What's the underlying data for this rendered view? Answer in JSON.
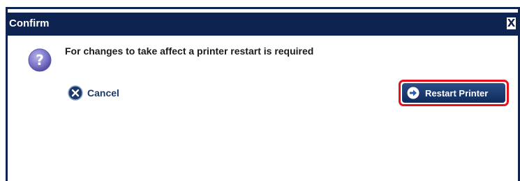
{
  "dialog": {
    "title": "Confirm",
    "close_label": "X",
    "message": "For changes to take affect a printer restart is required",
    "cancel_label": "Cancel",
    "restart_label": "Restart Printer"
  },
  "colors": {
    "titlebar": "#0f2350",
    "highlight": "#e8101a",
    "button": "#1b3a6b"
  },
  "icons": {
    "question": "question-icon",
    "cancel": "cancel-icon",
    "restart": "arrow-right-icon",
    "close": "close-icon"
  }
}
